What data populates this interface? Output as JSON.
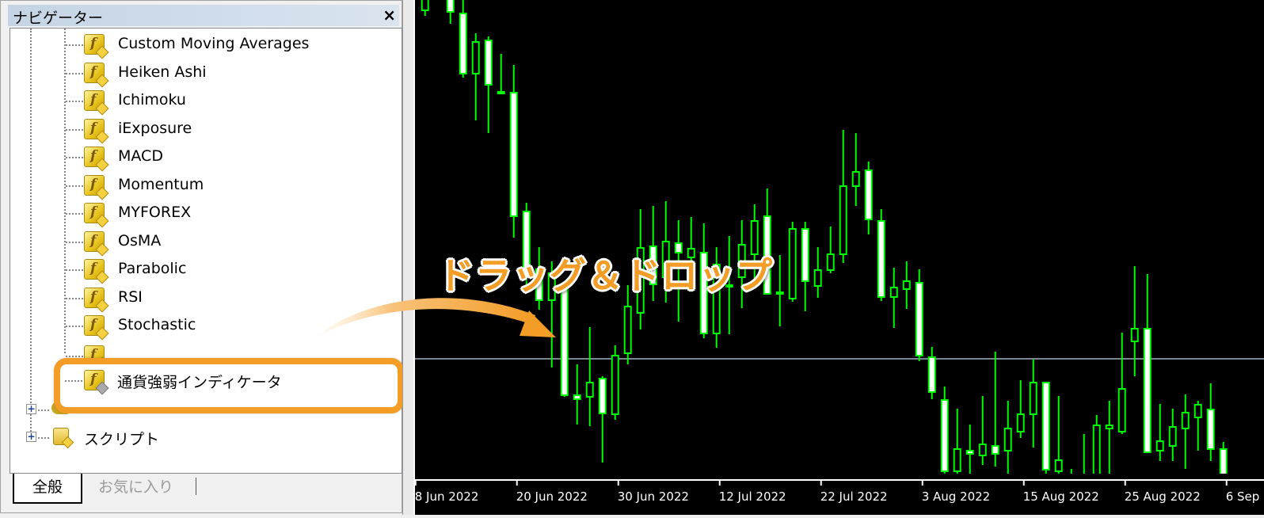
{
  "navigator": {
    "title": "ナビゲーター",
    "close_label": "×",
    "indicators": [
      {
        "label": "Custom Moving Averages",
        "icon": "custom-indicator-icon"
      },
      {
        "label": "Heiken Ashi",
        "icon": "custom-indicator-icon"
      },
      {
        "label": "Ichimoku",
        "icon": "custom-indicator-icon"
      },
      {
        "label": "iExposure",
        "icon": "custom-indicator-icon"
      },
      {
        "label": "MACD",
        "icon": "custom-indicator-icon"
      },
      {
        "label": "Momentum",
        "icon": "custom-indicator-icon"
      },
      {
        "label": "MYFOREX",
        "icon": "custom-indicator-icon"
      },
      {
        "label": "OsMA",
        "icon": "custom-indicator-icon"
      },
      {
        "label": "Parabolic",
        "icon": "custom-indicator-icon"
      },
      {
        "label": "RSI",
        "icon": "custom-indicator-icon"
      },
      {
        "label": "Stochastic",
        "icon": "custom-indicator-icon"
      }
    ],
    "highlighted_item": {
      "label": "通貨強弱インディケータ",
      "icon": "custom-indicator-icon"
    },
    "scripts_folder": {
      "label": "スクリプト",
      "expand": "+"
    },
    "expert_folder": {
      "expand": "+"
    },
    "tabs": [
      {
        "label": "全般",
        "active": true
      },
      {
        "label": "お気に入り",
        "active": false
      }
    ]
  },
  "annotation": {
    "text": "ドラッグ＆ドロップ",
    "color": "#f39c26"
  },
  "colors": {
    "candle": "#00ff00",
    "bear_fill": "#ffffff",
    "bull_fill": "#000000",
    "background": "#000000",
    "hline": "#7b8591",
    "highlight": "#f39c26"
  },
  "chart_data": {
    "type": "candlestick",
    "ylim": [
      52,
      650
    ],
    "horizontal_line": 197,
    "x_ticks": [
      {
        "label": "8 Jun 2022",
        "index": -1
      },
      {
        "label": "20 Jun 2022",
        "index": 7
      },
      {
        "label": "30 Jun 2022",
        "index": 15
      },
      {
        "label": "12 Jul 2022",
        "index": 23
      },
      {
        "label": "22 Jul 2022",
        "index": 31
      },
      {
        "label": "3 Aug 2022",
        "index": 39
      },
      {
        "label": "15 Aug 2022",
        "index": 47
      },
      {
        "label": "25 Aug 2022",
        "index": 55
      },
      {
        "label": "6 Sep",
        "index": 63
      }
    ],
    "ohlc": [
      [
        637,
        680,
        630,
        670
      ],
      [
        710,
        720,
        665,
        675
      ],
      [
        670,
        680,
        620,
        635
      ],
      [
        633,
        655,
        552,
        557
      ],
      [
        557,
        608,
        498,
        597
      ],
      [
        599,
        604,
        482,
        543
      ],
      [
        534,
        582,
        531,
        532
      ],
      [
        533,
        568,
        350,
        377
      ],
      [
        383,
        394,
        290,
        305
      ],
      [
        310,
        338,
        259,
        271
      ],
      [
        271,
        320,
        186,
        305
      ],
      [
        286,
        290,
        149,
        151
      ],
      [
        151,
        190,
        114,
        146
      ],
      [
        149,
        237,
        112,
        167
      ],
      [
        172,
        175,
        66,
        128
      ],
      [
        127,
        214,
        120,
        201
      ],
      [
        204,
        290,
        190,
        263
      ],
      [
        255,
        386,
        234,
        337
      ],
      [
        339,
        390,
        270,
        291
      ],
      [
        300,
        396,
        268,
        345
      ],
      [
        343,
        372,
        244,
        331
      ],
      [
        325,
        376,
        293,
        336
      ],
      [
        331,
        368,
        223,
        229
      ],
      [
        229,
        338,
        211,
        316
      ],
      [
        290,
        352,
        228,
        288
      ],
      [
        300,
        372,
        261,
        341
      ],
      [
        329,
        392,
        287,
        371
      ],
      [
        377,
        412,
        278,
        279
      ],
      [
        281,
        328,
        238,
        279
      ],
      [
        273,
        370,
        269,
        361
      ],
      [
        361,
        370,
        257,
        295
      ],
      [
        289,
        338,
        274,
        309
      ],
      [
        309,
        364,
        305,
        329
      ],
      [
        329,
        486,
        318,
        415
      ],
      [
        415,
        482,
        390,
        433
      ],
      [
        435,
        446,
        354,
        373
      ],
      [
        371,
        386,
        270,
        275
      ],
      [
        275,
        312,
        236,
        287
      ],
      [
        285,
        320,
        260,
        295
      ],
      [
        293,
        310,
        194,
        201
      ],
      [
        199,
        212,
        146,
        155
      ],
      [
        145,
        162,
        50,
        55
      ],
      [
        55,
        134,
        50,
        83
      ],
      [
        81,
        114,
        50,
        77
      ],
      [
        75,
        150,
        63,
        89
      ],
      [
        87,
        206,
        61,
        77
      ],
      [
        81,
        144,
        50,
        109
      ],
      [
        105,
        170,
        97,
        127
      ],
      [
        127,
        196,
        85,
        167
      ],
      [
        167,
        168,
        50,
        57
      ],
      [
        55,
        150,
        50,
        69
      ],
      [
        40,
        58,
        25,
        30
      ],
      [
        45,
        102,
        30,
        35
      ],
      [
        40,
        126,
        35,
        113
      ],
      [
        109,
        144,
        50,
        113
      ],
      [
        105,
        230,
        102,
        159
      ],
      [
        219,
        314,
        175,
        235
      ],
      [
        235,
        304,
        78,
        79
      ],
      [
        81,
        140,
        68,
        93
      ],
      [
        87,
        134,
        68,
        111
      ],
      [
        109,
        152,
        58,
        129
      ],
      [
        123,
        144,
        81,
        139
      ],
      [
        133,
        166,
        68,
        83
      ],
      [
        83,
        92,
        35,
        40
      ]
    ]
  }
}
